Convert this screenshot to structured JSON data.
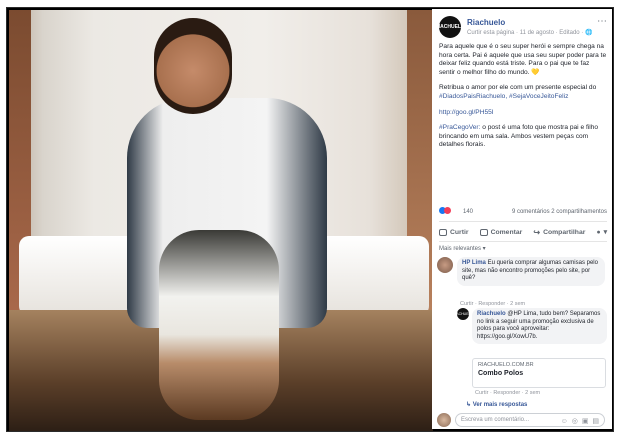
{
  "post_header": {
    "avatar_text": "RIACHUELO",
    "page_name": "Riachuelo",
    "meta": "Curtir esta página · 11 de agosto · Editado · 🌐",
    "more_icon": "more-icon"
  },
  "post_body": {
    "p1": "Para aquele que é o seu super herói e sempre chega na hora certa. Pai é aquele que usa seu super poder para te deixar feliz quando está triste. Para o pai que te faz sentir o melhor filho do mundo. 💛",
    "p2_text": "Retribua o amor por ele com um presente especial do ",
    "p2_tags": "#DiadosPaisRiachuelo, #SejaVoceJeitoFeliz",
    "p3_link": "http://goo.gl/PH55I",
    "p4_tag": "#PraCegoVer:",
    "p4_text": " o post é uma foto que mostra pai e filho brincando em uma sala. Ambos vestem peças com detalhes florais."
  },
  "reactions": {
    "count": "140",
    "summary": "9 comentários  2 compartilhamentos"
  },
  "actions": {
    "like": "Curtir",
    "comment": "Comentar",
    "share": "Compartilhar"
  },
  "sort_label": "Mais relevantes ▾",
  "comment1": {
    "name": "HP Lima",
    "text": " Eu queria comprar algumas camisas pelo site, mas não encontro promoções pelo site, por quê?",
    "meta": "Curtir · Responder · 2 sem"
  },
  "comment2": {
    "avatar_text": "RIACHUELO",
    "name": "Riachuelo",
    "text": " @HP Lima, tudo bem? Separamos no link a seguir uma promoção exclusiva de polos para você aproveitar: https://goo.gl/XowU7b.",
    "preview_domain": "RIACHUELO.COM.BR",
    "preview_title": "Combo Polos",
    "meta": "Curtir · Responder · 2 sem"
  },
  "more_replies": "↳ Ver mais respostas",
  "composer": {
    "placeholder": "Escreva um comentário...",
    "icons": "☺ ◎ ▣ ▤"
  }
}
